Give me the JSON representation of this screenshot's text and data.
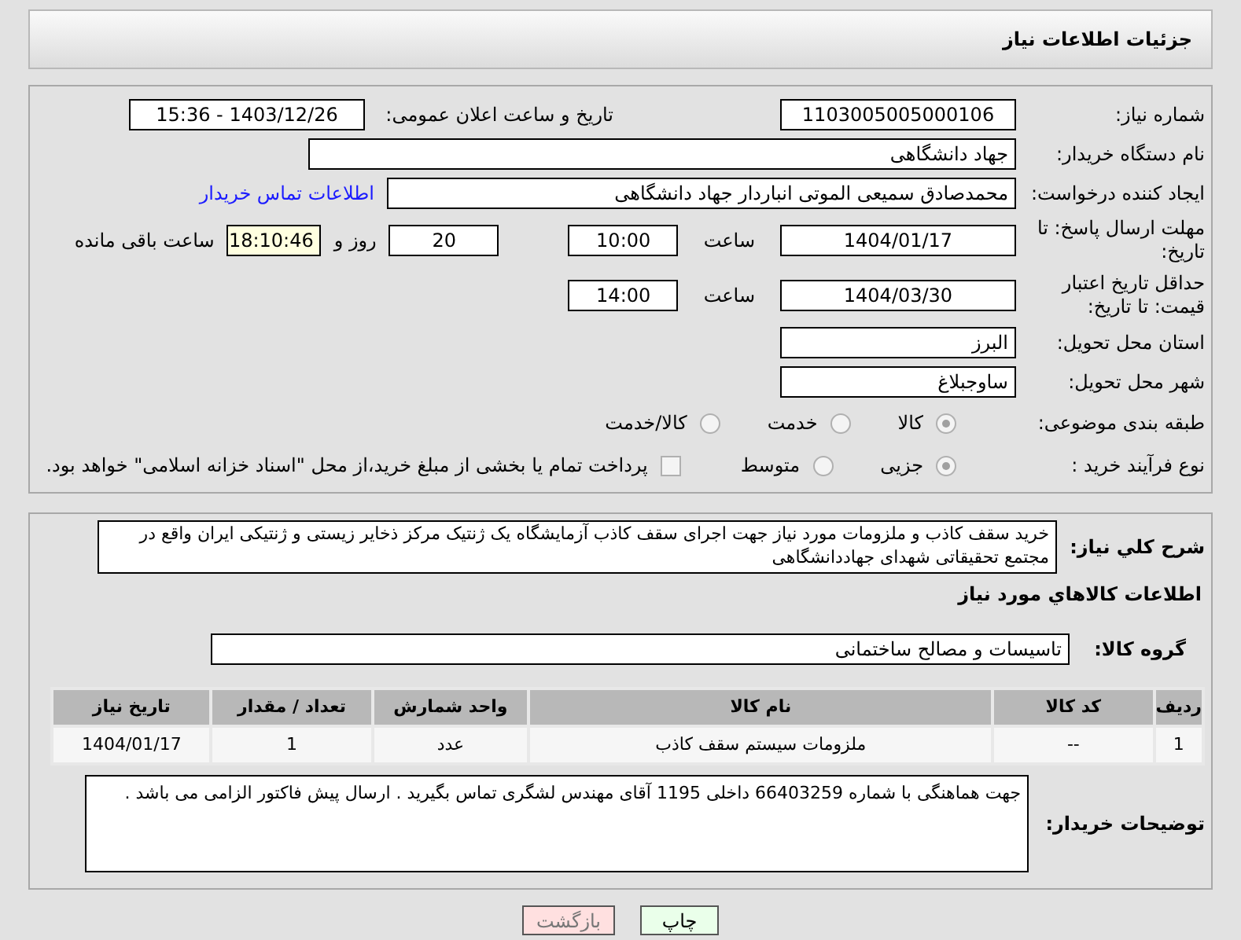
{
  "header": {
    "title": "جزئیات اطلاعات نیاز"
  },
  "need_number": {
    "label": "شماره نیاز:",
    "value": "1103005005000106"
  },
  "announce": {
    "label": "تاریخ و ساعت اعلان عمومی:",
    "value": "1403/12/26 - 15:36"
  },
  "buyer_org": {
    "label": "نام دستگاه خریدار:",
    "value": "جهاد دانشگاهی"
  },
  "requester": {
    "label": "ایجاد کننده درخواست:",
    "value": "محمدصادق سمیعی الموتی انباردار جهاد دانشگاهی",
    "link": "اطلاعات تماس خریدار"
  },
  "response_deadline": {
    "label": "مهلت ارسال پاسخ: تا تاریخ:",
    "date": "1404/01/17",
    "time_label": "ساعت",
    "time": "10:00",
    "days": "20",
    "days_label": "روز و",
    "remaining": "18:10:46",
    "remaining_label": "ساعت باقی مانده"
  },
  "price_validity": {
    "label": "حداقل تاریخ اعتبار قیمت: تا تاریخ:",
    "date": "1404/03/30",
    "time_label": "ساعت",
    "time": "14:00"
  },
  "province": {
    "label": "استان محل تحویل:",
    "value": "البرز"
  },
  "city": {
    "label": "شهر محل تحویل:",
    "value": "ساوجبلاغ"
  },
  "category": {
    "label": "طبقه بندی موضوعی:",
    "options": [
      {
        "label": "کالا",
        "selected": true
      },
      {
        "label": "خدمت",
        "selected": false
      },
      {
        "label": "کالا/خدمت",
        "selected": false
      }
    ]
  },
  "process": {
    "label": "نوع فرآیند خرید :",
    "options": [
      {
        "label": "جزیی",
        "selected": true
      },
      {
        "label": "متوسط",
        "selected": false
      }
    ],
    "payment": {
      "checked": false,
      "label": "پرداخت تمام یا بخشی از مبلغ خرید،از محل \"اسناد خزانه اسلامی\" خواهد بود."
    }
  },
  "description": {
    "label": "شرح کلي نياز:",
    "value": "خرید سقف کاذب و ملزومات مورد نیاز جهت اجرای سقف کاذب آزمایشگاه یک ژنتیک مرکز ذخایر زیستی و ژنتیکی ایران واقع در مجتمع تحقیقاتی شهدای جهاددانشگاهی"
  },
  "goods_title": "اطلاعات کالاهاي مورد نياز",
  "goods_group": {
    "label": "گروه کالا:",
    "value": "تاسیسات و مصالح ساختمانی"
  },
  "table": {
    "columns": [
      "ردیف",
      "کد کالا",
      "نام کالا",
      "واحد شمارش",
      "تعداد / مقدار",
      "تاریخ نیاز"
    ],
    "rows": [
      [
        "1",
        "--",
        "ملزومات سیستم سقف کاذب",
        "عدد",
        "1",
        "1404/01/17"
      ]
    ]
  },
  "buyer_notes": {
    "label": "توضیحات خریدار:",
    "value": "جهت هماهنگی با شماره 66403259 داخلی 1195 آقای مهندس لشگری تماس بگیرید . ارسال پیش فاکتور الزامی می باشد ."
  },
  "buttons": [
    {
      "label": "چاپ",
      "kind": "print"
    },
    {
      "label": "بازگشت",
      "kind": "back"
    }
  ]
}
